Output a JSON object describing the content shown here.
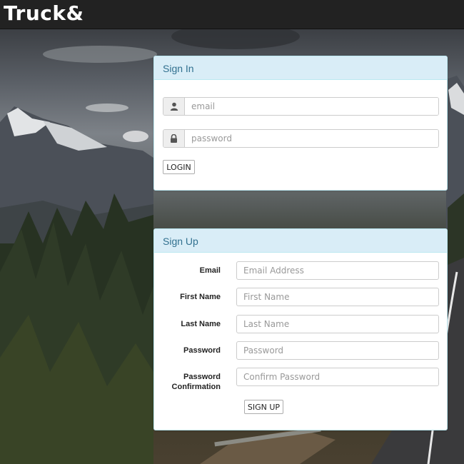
{
  "navbar": {
    "brand": "Truck&"
  },
  "signin": {
    "heading": "Sign In",
    "email_placeholder": "email",
    "password_placeholder": "password",
    "login_label": "LOGIN",
    "email_icon": "user-icon",
    "password_icon": "lock-icon"
  },
  "signup": {
    "heading": "Sign Up",
    "fields": [
      {
        "label": "Email",
        "placeholder": "Email Address"
      },
      {
        "label": "First Name",
        "placeholder": "First Name"
      },
      {
        "label": "Last Name",
        "placeholder": "Last Name"
      },
      {
        "label": "Password",
        "placeholder": "Password"
      },
      {
        "label": "Password Confirmation",
        "placeholder": "Confirm Password"
      }
    ],
    "submit_label": "SIGN UP"
  },
  "colors": {
    "navbar_bg": "#222222",
    "panel_heading_bg": "#d9edf7",
    "panel_heading_text": "#31708f",
    "panel_border": "#bce8f1"
  }
}
